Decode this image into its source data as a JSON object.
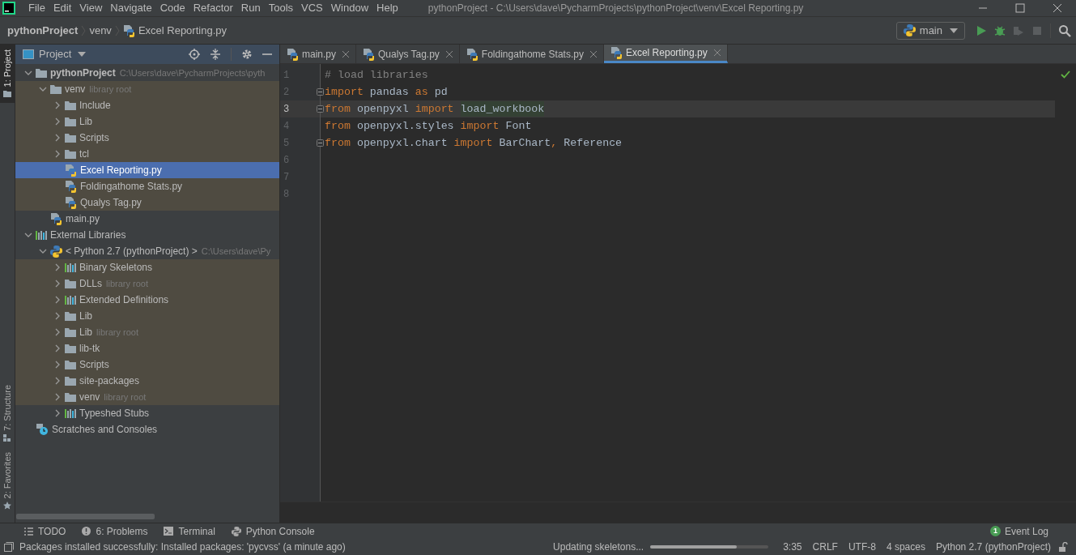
{
  "menu_bar": {
    "items": [
      "File",
      "Edit",
      "View",
      "Navigate",
      "Code",
      "Refactor",
      "Run",
      "Tools",
      "VCS",
      "Window",
      "Help"
    ],
    "title": "pythonProject - C:\\Users\\dave\\PycharmProjects\\pythonProject\\venv\\Excel Reporting.py"
  },
  "breadcrumbs": [
    {
      "label": "pythonProject",
      "kind": "project"
    },
    {
      "label": "venv",
      "kind": "folder"
    },
    {
      "label": "Excel Reporting.py",
      "kind": "python"
    }
  ],
  "run_config": {
    "label": "main"
  },
  "left_stripe": [
    {
      "label": "1: Project",
      "selected": true
    },
    {
      "label": "7: Structure",
      "selected": false
    },
    {
      "label": "2: Favorites",
      "selected": false
    }
  ],
  "project_panel": {
    "title": "Project",
    "tree": [
      {
        "label": "pythonProject",
        "hint": "C:\\Users\\dave\\PycharmProjects\\pyth",
        "kind": "project",
        "expanded": true,
        "library": false,
        "selected": false,
        "children": [
          {
            "label": "venv",
            "hint": "library root",
            "kind": "folder",
            "expanded": true,
            "library": true,
            "selected": false,
            "children": [
              {
                "label": "Include",
                "kind": "folder",
                "expanded": false,
                "library": true,
                "selected": false
              },
              {
                "label": "Lib",
                "kind": "folder",
                "expanded": false,
                "library": true,
                "selected": false
              },
              {
                "label": "Scripts",
                "kind": "folder",
                "expanded": false,
                "library": true,
                "selected": false
              },
              {
                "label": "tcl",
                "kind": "folder",
                "expanded": false,
                "library": true,
                "selected": false
              },
              {
                "label": "Excel Reporting.py",
                "kind": "python",
                "selected": true
              },
              {
                "label": "Foldingathome Stats.py",
                "kind": "python",
                "library": true,
                "selected": false
              },
              {
                "label": "Qualys Tag.py",
                "kind": "python",
                "library": true,
                "selected": false
              }
            ]
          },
          {
            "label": "main.py",
            "kind": "python",
            "library": false,
            "selected": false
          }
        ]
      },
      {
        "label": "External Libraries",
        "kind": "library",
        "expanded": true,
        "library": false,
        "selected": false,
        "children": [
          {
            "label": "< Python 2.7 (pythonProject) >",
            "hint": "C:\\Users\\dave\\Py",
            "kind": "sdk",
            "expanded": true,
            "library": false,
            "selected": false,
            "children": [
              {
                "label": "Binary Skeletons",
                "kind": "library",
                "expanded": false,
                "library": true,
                "selected": false
              },
              {
                "label": "DLLs",
                "hint": "library root",
                "kind": "folder",
                "expanded": false,
                "library": true,
                "selected": false
              },
              {
                "label": "Extended Definitions",
                "kind": "library",
                "expanded": false,
                "library": true,
                "selected": false
              },
              {
                "label": "Lib",
                "kind": "folder",
                "expanded": false,
                "library": true,
                "selected": false
              },
              {
                "label": "Lib",
                "hint": "library root",
                "kind": "folder",
                "expanded": false,
                "library": true,
                "selected": false
              },
              {
                "label": "lib-tk",
                "kind": "folder",
                "expanded": false,
                "library": true,
                "selected": false
              },
              {
                "label": "Scripts",
                "kind": "folder",
                "expanded": false,
                "library": true,
                "selected": false
              },
              {
                "label": "site-packages",
                "kind": "folder",
                "expanded": false,
                "library": true,
                "selected": false
              },
              {
                "label": "venv",
                "hint": "library root",
                "kind": "folder",
                "expanded": false,
                "library": true,
                "selected": false
              },
              {
                "label": "Typeshed Stubs",
                "kind": "library",
                "expanded": false,
                "library": false,
                "selected": false
              }
            ]
          }
        ]
      },
      {
        "label": "Scratches and Consoles",
        "kind": "scratch",
        "library": false,
        "selected": false
      }
    ]
  },
  "editor_tabs": [
    {
      "label": "main.py",
      "selected": false
    },
    {
      "label": "Qualys Tag.py",
      "selected": false
    },
    {
      "label": "Foldingathome Stats.py",
      "selected": false
    },
    {
      "label": "Excel Reporting.py",
      "selected": true
    }
  ],
  "code_lines": [
    {
      "number": "1",
      "current": false,
      "tokens": [
        {
          "kind": "comment",
          "text": "# load libraries"
        }
      ]
    },
    {
      "number": "2",
      "current": false,
      "fold": true,
      "tokens": [
        {
          "kind": "keyword",
          "text": "import"
        },
        {
          "kind": "plain",
          "text": " pandas "
        },
        {
          "kind": "keyword",
          "text": "as"
        },
        {
          "kind": "plain",
          "text": " pd"
        }
      ]
    },
    {
      "number": "3",
      "current": true,
      "fold": true,
      "tokens": [
        {
          "kind": "keyword",
          "text": "from"
        },
        {
          "kind": "plain",
          "text": " openpyxl "
        },
        {
          "kind": "keyword",
          "text": "import "
        },
        {
          "kind": "usage",
          "text": "load_workbook"
        }
      ]
    },
    {
      "number": "4",
      "current": false,
      "tokens": [
        {
          "kind": "keyword",
          "text": "from"
        },
        {
          "kind": "plain",
          "text": " openpyxl.styles "
        },
        {
          "kind": "keyword",
          "text": "import"
        },
        {
          "kind": "plain",
          "text": " Font"
        }
      ]
    },
    {
      "number": "5",
      "current": false,
      "fold": true,
      "tokens": [
        {
          "kind": "keyword",
          "text": "from"
        },
        {
          "kind": "plain",
          "text": " openpyxl.chart "
        },
        {
          "kind": "keyword",
          "text": "import"
        },
        {
          "kind": "plain",
          "text": " BarChart"
        },
        {
          "kind": "keyword",
          "text": ","
        },
        {
          "kind": "plain",
          "text": " Reference"
        }
      ]
    },
    {
      "number": "6",
      "current": false
    },
    {
      "number": "7",
      "current": false
    },
    {
      "number": "8",
      "current": false
    }
  ],
  "tool_tabs": [
    {
      "label": "TODO",
      "kind": "list"
    },
    {
      "label": "6: Problems",
      "kind": "problems"
    },
    {
      "label": "Terminal",
      "kind": "terminal"
    },
    {
      "label": "Python Console",
      "kind": "python"
    }
  ],
  "event_log": {
    "label": "Event Log",
    "count": "1"
  },
  "status_bar": {
    "message": "Packages installed successfully: Installed packages: 'pycvss' (a minute ago)",
    "task": "Updating skeletons...",
    "level": 0.73,
    "items": [
      "3:35",
      "CRLF",
      "UTF-8",
      "4 spaces",
      "Python 2.7 (pythonProject)"
    ]
  }
}
